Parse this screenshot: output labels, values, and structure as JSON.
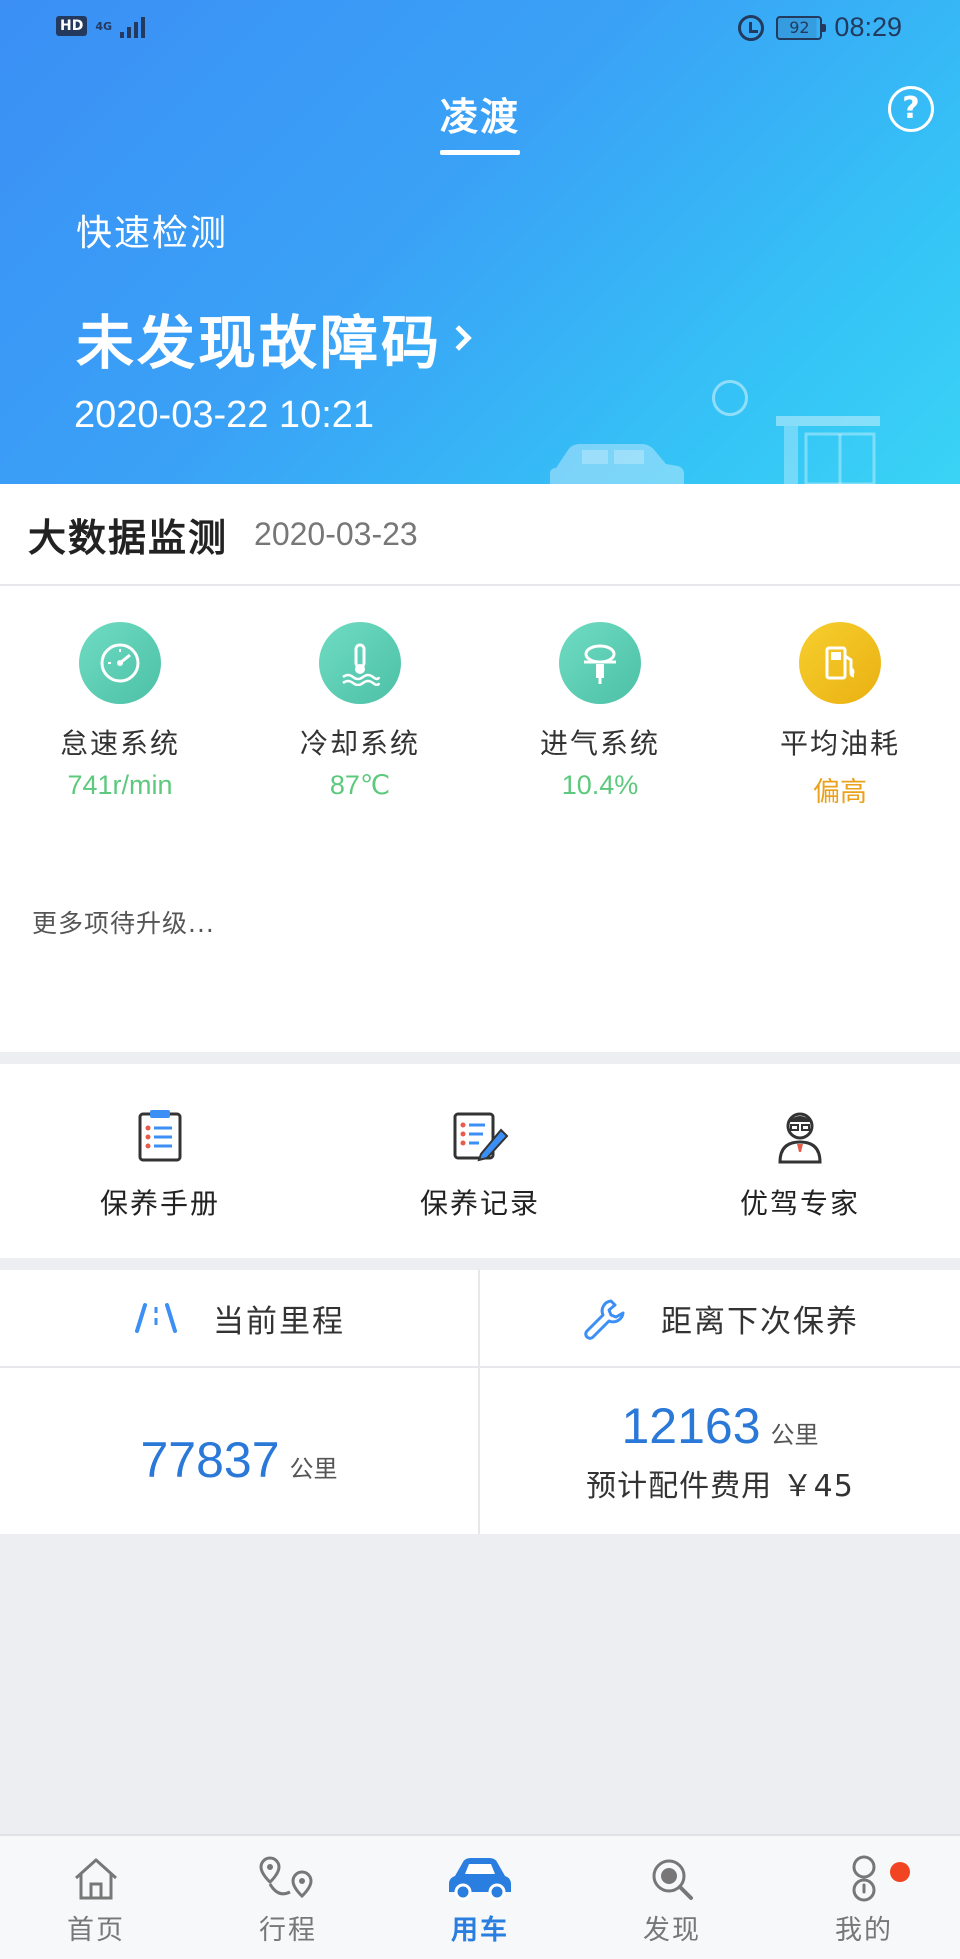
{
  "status_bar": {
    "hd": "HD",
    "network": "4G",
    "battery": "92",
    "time": "08:29"
  },
  "header": {
    "title": "凌渡",
    "help": "?"
  },
  "hero": {
    "subtitle": "快速检测",
    "main": "未发现故障码",
    "datetime": "2020-03-22 10:21"
  },
  "big_data": {
    "title": "大数据监测",
    "date": "2020-03-23",
    "metrics": [
      {
        "label": "怠速系统",
        "value": "741r/min",
        "color": "#5cc97c",
        "icon": "speedometer-icon"
      },
      {
        "label": "冷却系统",
        "value": "87℃",
        "color": "#5cc97c",
        "icon": "thermometer-icon"
      },
      {
        "label": "进气系统",
        "value": "10.4%",
        "color": "#5cc97c",
        "icon": "air-intake-icon"
      },
      {
        "label": "平均油耗",
        "value": "偏高",
        "color": "#eaa21c",
        "icon": "fuel-pump-icon"
      }
    ],
    "more": "更多项待升级..."
  },
  "services": [
    {
      "label": "保养手册"
    },
    {
      "label": "保养记录"
    },
    {
      "label": "优驾专家"
    }
  ],
  "mileage": {
    "current_title": "当前里程",
    "current_value": "77837",
    "current_unit": "公里",
    "next_title": "距离下次保养",
    "next_value": "12163",
    "next_unit": "公里",
    "fee_label": "预计配件费用",
    "fee_value": "￥45"
  },
  "tabs": [
    {
      "label": "首页"
    },
    {
      "label": "行程"
    },
    {
      "label": "用车"
    },
    {
      "label": "发现"
    },
    {
      "label": "我的"
    }
  ],
  "colors": {
    "accent": "#2a7ee0",
    "metric_green": "#5cc97c",
    "metric_amber": "#eaa21c",
    "badge_red": "#f04423"
  }
}
